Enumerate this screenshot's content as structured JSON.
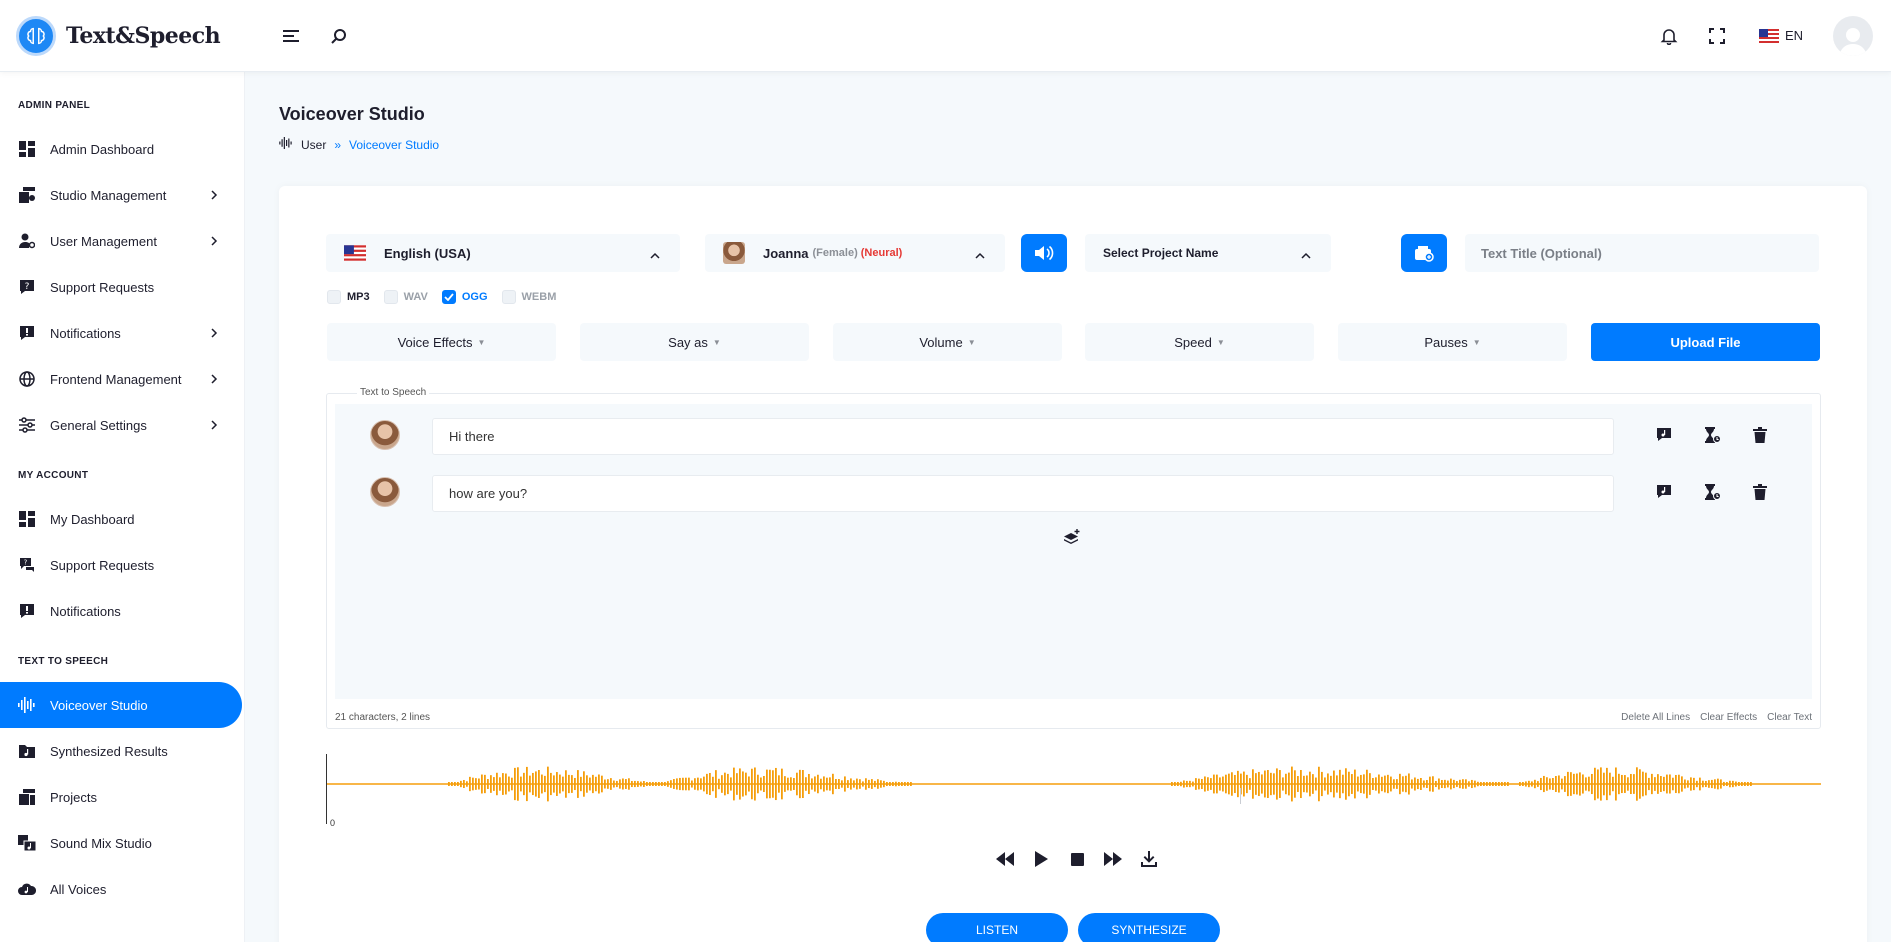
{
  "app": {
    "brand": "Text&Speech"
  },
  "header": {
    "language": "EN"
  },
  "sidebar": {
    "sections": [
      {
        "title": "ADMIN PANEL",
        "items": [
          {
            "label": "Admin Dashboard",
            "icon": "dashboard-icon",
            "chevron": false
          },
          {
            "label": "Studio Management",
            "icon": "studio-icon",
            "chevron": true
          },
          {
            "label": "User Management",
            "icon": "user-gear-icon",
            "chevron": true
          },
          {
            "label": "Support Requests",
            "icon": "question-icon",
            "chevron": false
          },
          {
            "label": "Notifications",
            "icon": "alert-icon",
            "chevron": true
          },
          {
            "label": "Frontend Management",
            "icon": "globe-icon",
            "chevron": true
          },
          {
            "label": "General Settings",
            "icon": "sliders-icon",
            "chevron": true
          }
        ]
      },
      {
        "title": "MY ACCOUNT",
        "items": [
          {
            "label": "My Dashboard",
            "icon": "dashboard-icon",
            "chevron": false
          },
          {
            "label": "Support Requests",
            "icon": "question-icon",
            "chevron": false
          },
          {
            "label": "Notifications",
            "icon": "alert-icon",
            "chevron": false
          }
        ]
      },
      {
        "title": "TEXT TO SPEECH",
        "items": [
          {
            "label": "Voiceover Studio",
            "icon": "waveform-icon",
            "chevron": false,
            "active": true
          },
          {
            "label": "Synthesized Results",
            "icon": "music-folder-icon",
            "chevron": false
          },
          {
            "label": "Projects",
            "icon": "projects-icon",
            "chevron": false
          },
          {
            "label": "Sound Mix Studio",
            "icon": "mix-icon",
            "chevron": false
          },
          {
            "label": "All Voices",
            "icon": "cloud-music-icon",
            "chevron": false
          }
        ]
      }
    ]
  },
  "page": {
    "title": "Voiceover Studio",
    "breadcrumb": {
      "parent": "User",
      "separator": "»",
      "current": "Voiceover Studio"
    }
  },
  "studio": {
    "language": "English (USA)",
    "voice": {
      "name": "Joanna",
      "gender": "(Female)",
      "type": "(Neural)"
    },
    "project_placeholder": "Select Project Name",
    "title_placeholder": "Text Title (Optional)",
    "formats": [
      {
        "label": "MP3",
        "checked": false
      },
      {
        "label": "WAV",
        "checked": false
      },
      {
        "label": "OGG",
        "checked": true
      },
      {
        "label": "WEBM",
        "checked": false
      }
    ],
    "options": [
      "Voice Effects",
      "Say as",
      "Volume",
      "Speed",
      "Pauses"
    ],
    "upload_label": "Upload File",
    "tts_legend": "Text to Speech",
    "lines": [
      "Hi there",
      "how are you?"
    ],
    "stats": "21 characters, 2 lines",
    "footer_actions": [
      "Delete All Lines",
      "Clear Effects",
      "Clear Text"
    ],
    "waveform_start": "0",
    "listen_label": "LISTEN",
    "synthesize_label": "SYNTHESIZE"
  },
  "colors": {
    "accent": "#007bff",
    "wave": "#f59e0b",
    "neural": "#e53935"
  }
}
